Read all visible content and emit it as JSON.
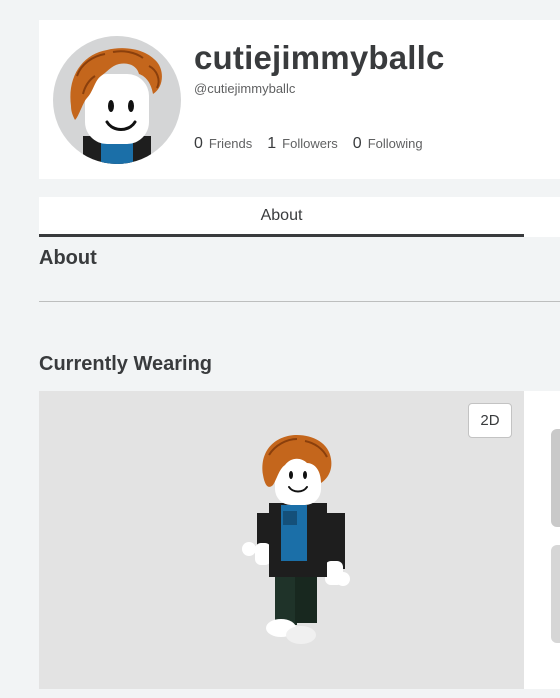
{
  "profile": {
    "display_name": "cutiejimmyballc",
    "username": "@cutiejimmyballc",
    "avatar_icon": "avatar-headshot-icon",
    "stats": [
      {
        "count": "0",
        "label": "Friends"
      },
      {
        "count": "1",
        "label": "Followers"
      },
      {
        "count": "0",
        "label": "Following"
      }
    ]
  },
  "tabs": {
    "about_label": "About"
  },
  "about_section": {
    "title": "About"
  },
  "wearing_section": {
    "title": "Currently Wearing",
    "toggle_label": "2D"
  },
  "colors": {
    "background": "#f2f4f5",
    "card": "#ffffff",
    "text_primary": "#393b3d",
    "hair": "#c4661c",
    "shirt_blue": "#1b6fa8",
    "jacket": "#1e1e1e",
    "pants": "#1f3329"
  }
}
